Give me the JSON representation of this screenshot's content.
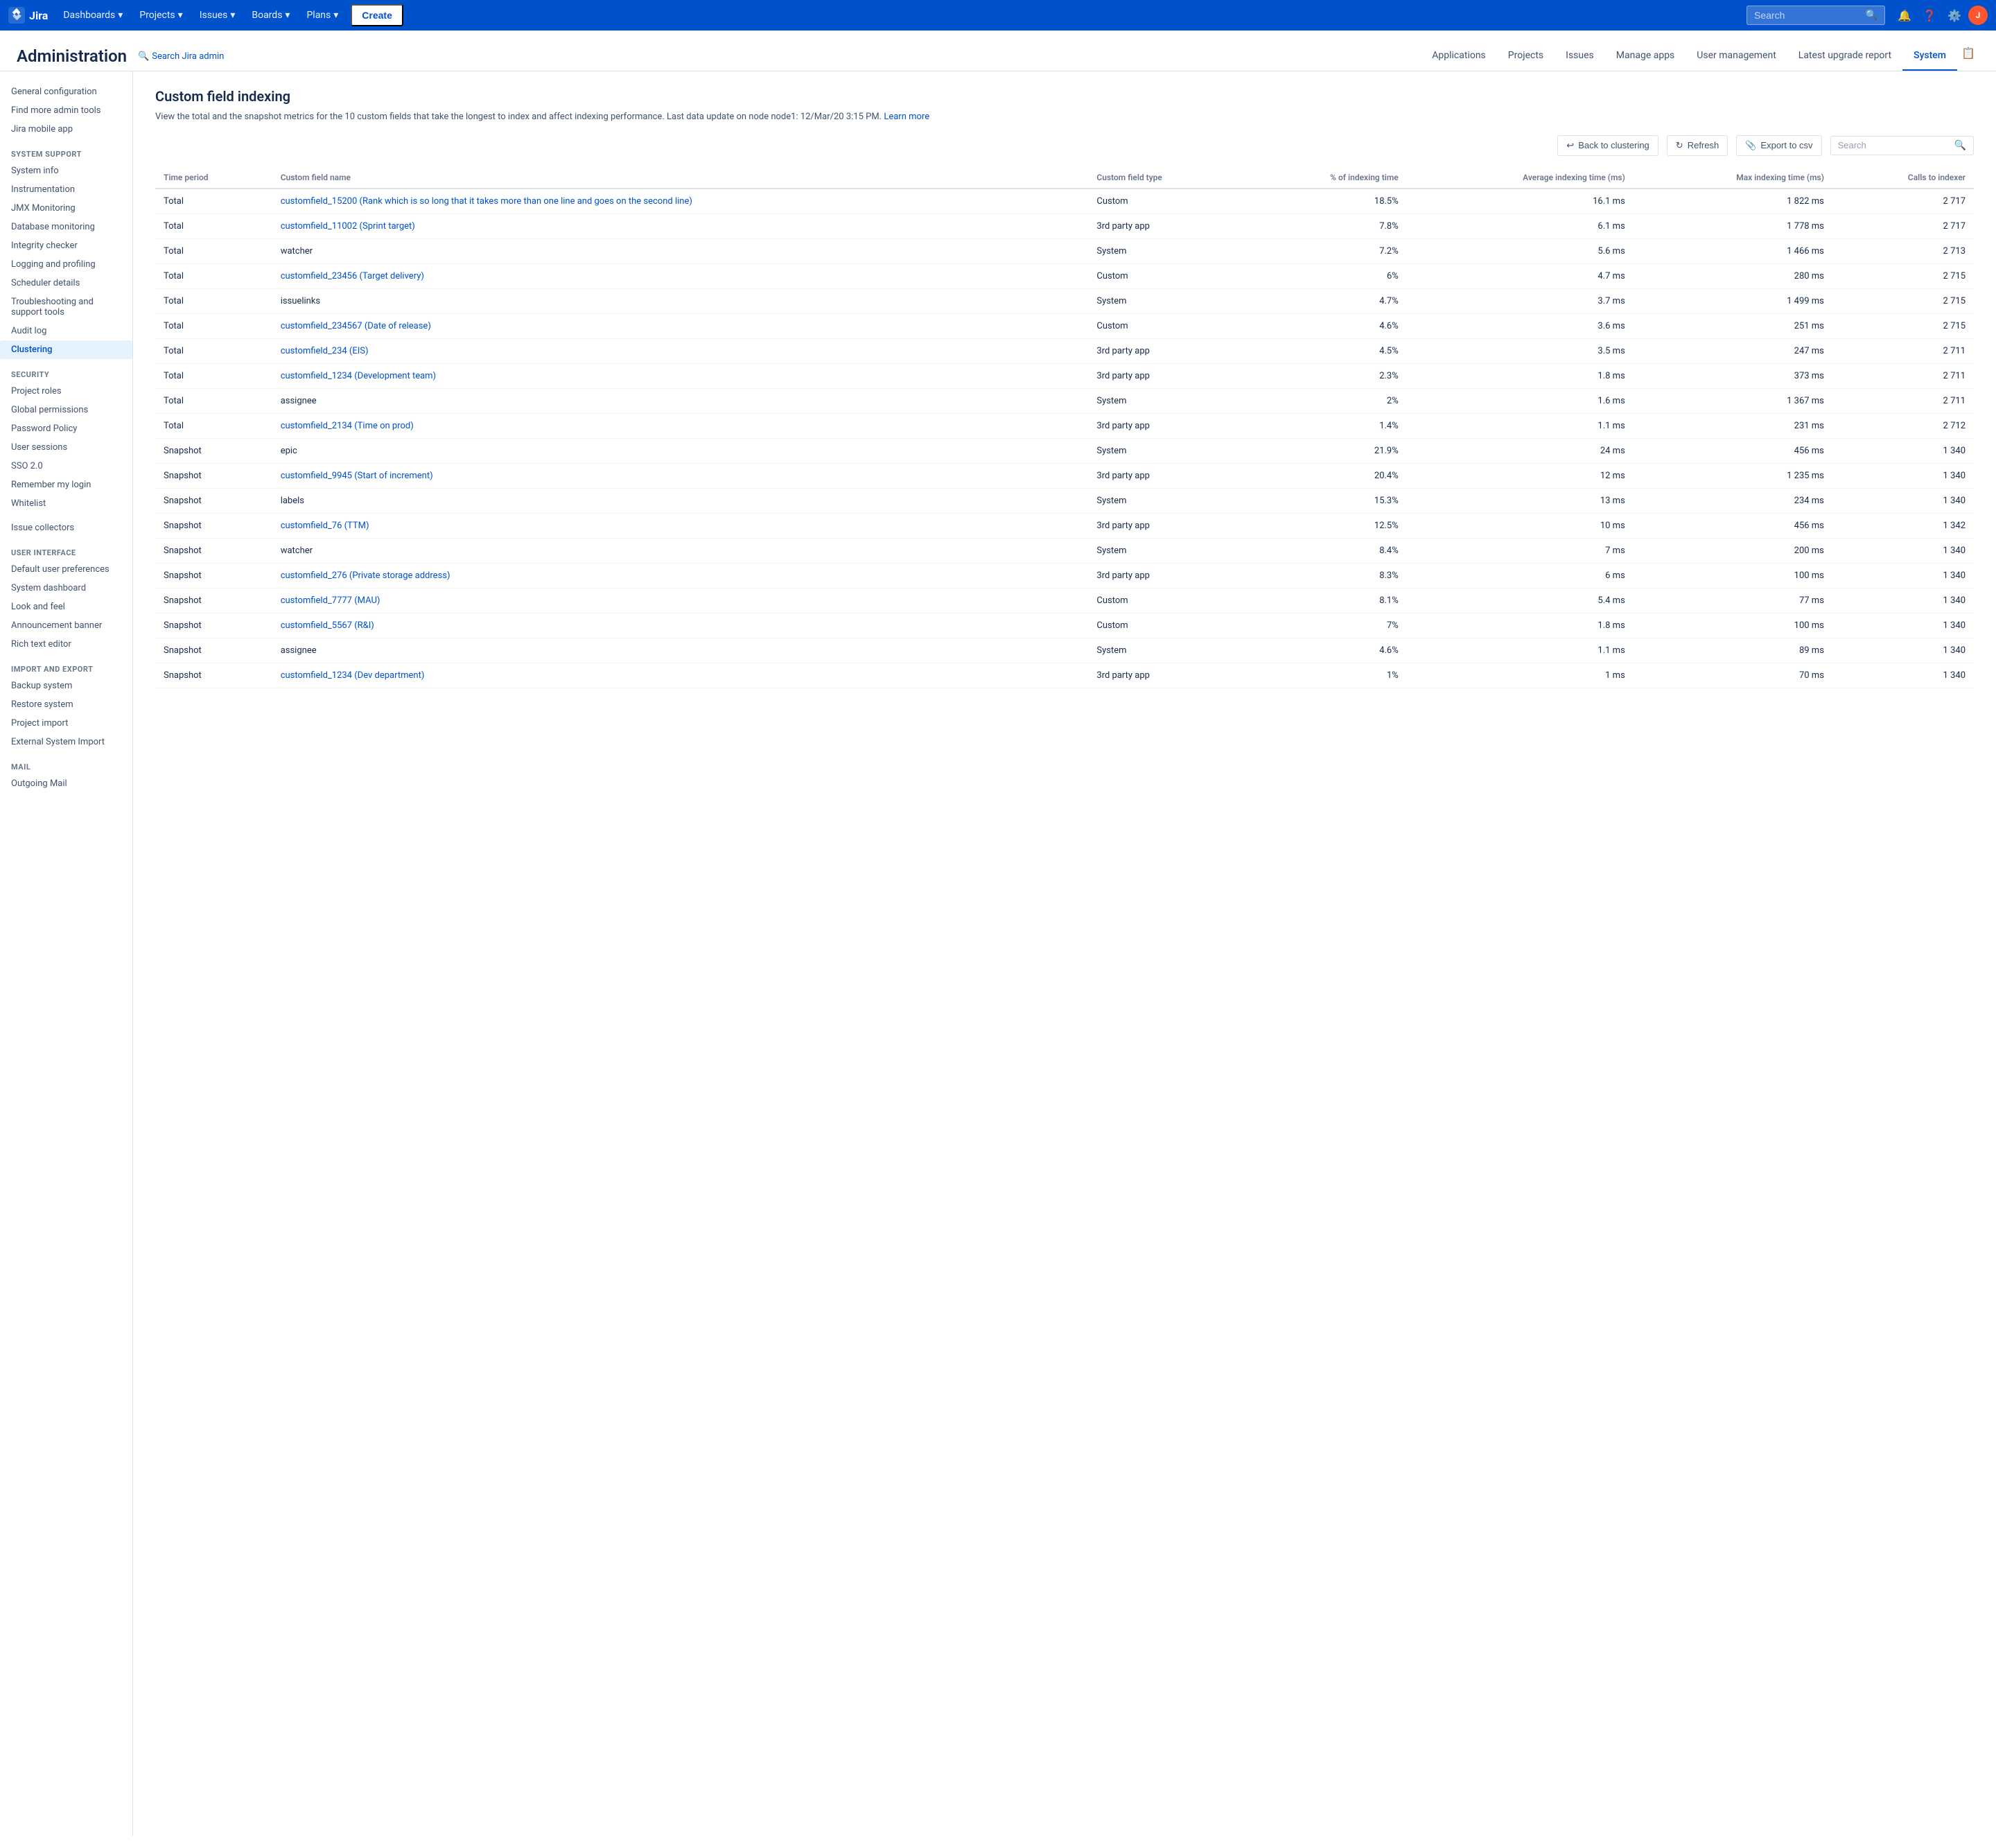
{
  "topNav": {
    "logo": "Jira",
    "navItems": [
      {
        "label": "Dashboards",
        "hasDropdown": true
      },
      {
        "label": "Projects",
        "hasDropdown": true
      },
      {
        "label": "Issues",
        "hasDropdown": true
      },
      {
        "label": "Boards",
        "hasDropdown": true
      },
      {
        "label": "Plans",
        "hasDropdown": true
      }
    ],
    "createLabel": "Create",
    "searchPlaceholder": "Search",
    "avatarInitial": "J"
  },
  "adminHeader": {
    "title": "Administration",
    "searchLink": "Search Jira admin",
    "tabs": [
      {
        "label": "Applications"
      },
      {
        "label": "Projects"
      },
      {
        "label": "Issues"
      },
      {
        "label": "Manage apps"
      },
      {
        "label": "User management"
      },
      {
        "label": "Latest upgrade report"
      },
      {
        "label": "System",
        "active": true
      }
    ]
  },
  "sidebar": {
    "topItems": [
      {
        "label": "General configuration"
      },
      {
        "label": "Find more admin tools"
      },
      {
        "label": "Jira mobile app"
      }
    ],
    "sections": [
      {
        "title": "SYSTEM SUPPORT",
        "items": [
          {
            "label": "System info"
          },
          {
            "label": "Instrumentation"
          },
          {
            "label": "JMX Monitoring"
          },
          {
            "label": "Database monitoring"
          },
          {
            "label": "Integrity checker"
          },
          {
            "label": "Logging and profiling"
          },
          {
            "label": "Scheduler details"
          },
          {
            "label": "Troubleshooting and support tools"
          },
          {
            "label": "Audit log"
          },
          {
            "label": "Clustering",
            "active": true
          }
        ]
      },
      {
        "title": "SECURITY",
        "items": [
          {
            "label": "Project roles"
          },
          {
            "label": "Global permissions"
          },
          {
            "label": "Password Policy"
          },
          {
            "label": "User sessions"
          },
          {
            "label": "SSO 2.0"
          },
          {
            "label": "Remember my login"
          },
          {
            "label": "Whitelist"
          }
        ]
      },
      {
        "title": "",
        "items": [
          {
            "label": "Issue collectors"
          }
        ]
      },
      {
        "title": "USER INTERFACE",
        "items": [
          {
            "label": "Default user preferences"
          },
          {
            "label": "System dashboard"
          },
          {
            "label": "Look and feel"
          },
          {
            "label": "Announcement banner"
          },
          {
            "label": "Rich text editor"
          }
        ]
      },
      {
        "title": "IMPORT AND EXPORT",
        "items": [
          {
            "label": "Backup system"
          },
          {
            "label": "Restore system"
          },
          {
            "label": "Project import"
          },
          {
            "label": "External System Import"
          }
        ]
      },
      {
        "title": "MAIL",
        "items": [
          {
            "label": "Outgoing Mail"
          }
        ]
      }
    ]
  },
  "main": {
    "pageTitle": "Custom field indexing",
    "pageDesc": "View the total and the snapshot metrics for the 10 custom fields that take the longest to index and affect indexing performance. Last data update on node node1: 12/Mar/20 3:15 PM.",
    "learnMoreLabel": "Learn more",
    "toolbar": {
      "backLabel": "Back to clustering",
      "refreshLabel": "Refresh",
      "exportLabel": "Export to csv",
      "searchPlaceholder": "Search"
    },
    "table": {
      "columns": [
        {
          "label": "Time period"
        },
        {
          "label": "Custom field name"
        },
        {
          "label": "Custom field type"
        },
        {
          "label": "% of indexing time",
          "right": true
        },
        {
          "label": "Average indexing time (ms)",
          "right": true
        },
        {
          "label": "Max indexing time (ms)",
          "right": true
        },
        {
          "label": "Calls to indexer",
          "right": true
        }
      ],
      "rows": [
        {
          "timePeriod": "Total",
          "fieldName": "customfield_15200 (Rank which is so long that it takes more than one line and goes on the second line)",
          "fieldType": "Custom",
          "pct": "18.5%",
          "avg": "16.1 ms",
          "max": "1 822 ms",
          "calls": "2 717",
          "isLink": true
        },
        {
          "timePeriod": "Total",
          "fieldName": "customfield_11002 (Sprint target)",
          "fieldType": "3rd party app",
          "pct": "7.8%",
          "avg": "6.1 ms",
          "max": "1 778 ms",
          "calls": "2 717",
          "isLink": true
        },
        {
          "timePeriod": "Total",
          "fieldName": "watcher",
          "fieldType": "System",
          "pct": "7.2%",
          "avg": "5.6 ms",
          "max": "1 466 ms",
          "calls": "2 713",
          "isLink": false
        },
        {
          "timePeriod": "Total",
          "fieldName": "customfield_23456 (Target delivery)",
          "fieldType": "Custom",
          "pct": "6%",
          "avg": "4.7 ms",
          "max": "280 ms",
          "calls": "2 715",
          "isLink": true
        },
        {
          "timePeriod": "Total",
          "fieldName": "issuelinks",
          "fieldType": "System",
          "pct": "4.7%",
          "avg": "3.7 ms",
          "max": "1 499 ms",
          "calls": "2 715",
          "isLink": false
        },
        {
          "timePeriod": "Total",
          "fieldName": "customfield_234567 (Date of release)",
          "fieldType": "Custom",
          "pct": "4.6%",
          "avg": "3.6 ms",
          "max": "251 ms",
          "calls": "2 715",
          "isLink": true
        },
        {
          "timePeriod": "Total",
          "fieldName": "customfield_234 (EIS)",
          "fieldType": "3rd party app",
          "pct": "4.5%",
          "avg": "3.5 ms",
          "max": "247 ms",
          "calls": "2 711",
          "isLink": true
        },
        {
          "timePeriod": "Total",
          "fieldName": "customfield_1234 (Development team)",
          "fieldType": "3rd party app",
          "pct": "2.3%",
          "avg": "1.8 ms",
          "max": "373 ms",
          "calls": "2 711",
          "isLink": true
        },
        {
          "timePeriod": "Total",
          "fieldName": "assignee",
          "fieldType": "System",
          "pct": "2%",
          "avg": "1.6 ms",
          "max": "1 367 ms",
          "calls": "2 711",
          "isLink": false
        },
        {
          "timePeriod": "Total",
          "fieldName": "customfield_2134 (Time on prod)",
          "fieldType": "3rd party app",
          "pct": "1.4%",
          "avg": "1.1 ms",
          "max": "231 ms",
          "calls": "2 712",
          "isLink": true
        },
        {
          "timePeriod": "Snapshot",
          "fieldName": "epic",
          "fieldType": "System",
          "pct": "21.9%",
          "avg": "24 ms",
          "max": "456 ms",
          "calls": "1 340",
          "isLink": false
        },
        {
          "timePeriod": "Snapshot",
          "fieldName": "customfield_9945 (Start of increment)",
          "fieldType": "3rd party app",
          "pct": "20.4%",
          "avg": "12 ms",
          "max": "1 235 ms",
          "calls": "1 340",
          "isLink": true
        },
        {
          "timePeriod": "Snapshot",
          "fieldName": "labels",
          "fieldType": "System",
          "pct": "15.3%",
          "avg": "13 ms",
          "max": "234 ms",
          "calls": "1 340",
          "isLink": false
        },
        {
          "timePeriod": "Snapshot",
          "fieldName": "customfield_76 (TTM)",
          "fieldType": "3rd party app",
          "pct": "12.5%",
          "avg": "10 ms",
          "max": "456 ms",
          "calls": "1 342",
          "isLink": true
        },
        {
          "timePeriod": "Snapshot",
          "fieldName": "watcher",
          "fieldType": "System",
          "pct": "8.4%",
          "avg": "7 ms",
          "max": "200 ms",
          "calls": "1 340",
          "isLink": false
        },
        {
          "timePeriod": "Snapshot",
          "fieldName": "customfield_276 (Private storage address)",
          "fieldType": "3rd party app",
          "pct": "8.3%",
          "avg": "6 ms",
          "max": "100 ms",
          "calls": "1 340",
          "isLink": true
        },
        {
          "timePeriod": "Snapshot",
          "fieldName": "customfield_7777 (MAU)",
          "fieldType": "Custom",
          "pct": "8.1%",
          "avg": "5.4 ms",
          "max": "77 ms",
          "calls": "1 340",
          "isLink": true
        },
        {
          "timePeriod": "Snapshot",
          "fieldName": "customfield_5567 (R&I)",
          "fieldType": "Custom",
          "pct": "7%",
          "avg": "1.8 ms",
          "max": "100 ms",
          "calls": "1 340",
          "isLink": true
        },
        {
          "timePeriod": "Snapshot",
          "fieldName": "assignee",
          "fieldType": "System",
          "pct": "4.6%",
          "avg": "1.1 ms",
          "max": "89 ms",
          "calls": "1 340",
          "isLink": false
        },
        {
          "timePeriod": "Snapshot",
          "fieldName": "customfield_1234 (Dev department)",
          "fieldType": "3rd party app",
          "pct": "1%",
          "avg": "1 ms",
          "max": "70 ms",
          "calls": "1 340",
          "isLink": true
        }
      ]
    }
  }
}
